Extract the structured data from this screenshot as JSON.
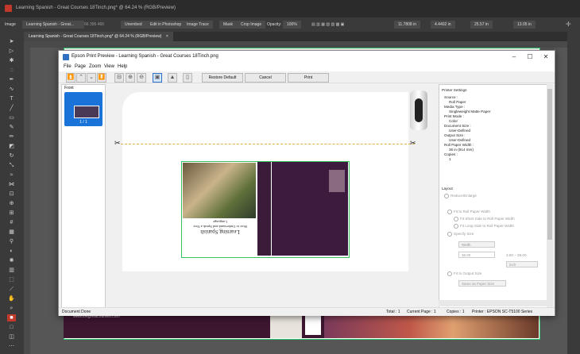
{
  "photoshop": {
    "window_title": "Learning Spanish - Great Courses 18Tinch.png* @ 64.24 % (RGB/Preview)",
    "options_bar": {
      "image_label": "Image",
      "tab_label": "Learning Spanish - Great...",
      "dims": "66  395  466",
      "unembed": "Unembed",
      "edit_in_photoshop": "Edit in Photoshop",
      "image_trace": "Image Trace",
      "mask": "Mask",
      "crop_image": "Crop Image",
      "opacity_label": "Opacity:",
      "opacity_value": "100%",
      "x_value": "11.7808 in",
      "y_value": "4.4402 in",
      "w_value": "25.57 in",
      "h_value": "13.05 in"
    },
    "doc_tab": "Learning Spanish - Great Courses 18Tinch.png* @ 64.24 % (RGB/Preview)",
    "doc_tab_close": "×",
    "artboard_text": [
      "www.thegreatcourses.com"
    ]
  },
  "dialog": {
    "title": "Epson Print Preview - Learning Spanish - Great Courses 18Tinch.png",
    "window_buttons": {
      "minimize": "–",
      "maximize": "☐",
      "close": "✕"
    },
    "menu": [
      "File",
      "Page",
      "Zoom",
      "View",
      "Help"
    ],
    "toolbar": {
      "restore_default": "Restore Default",
      "cancel": "Cancel",
      "print": "Print"
    },
    "thumbnail_panel": {
      "label": "Front",
      "page_caption": "1 / 1"
    },
    "preview": {
      "book_title": "Learning Spanish",
      "book_subtitle": "How to Understand and Speak a New Language"
    },
    "settings": {
      "printer_settings_label": "Printer Settings",
      "source_label": "Source :",
      "source_value": "Roll Paper",
      "media_type_label": "Media Type :",
      "media_type_value": "Singleweight Matte Paper",
      "print_mode_label": "Print Mode :",
      "print_mode_value": "Color",
      "document_size_label": "Document Size :",
      "document_size_value": "User-Defined",
      "output_size_label": "Output Size :",
      "output_size_value": "User-Defined",
      "roll_paper_width_label": "Roll Paper Width :",
      "roll_paper_width_value": "36 in (914 mm)",
      "copies_label": "Copies :",
      "copies_value": "1",
      "layout_label": "Layout",
      "reduce_enlarge": "Reduce/Enlarge",
      "fit_to_roll_paper_width": "Fit to Roll Paper Width",
      "fit_short_side": "Fit Short Side to Roll Paper Width",
      "fit_long_side": "Fit Long Side to Roll Paper Width",
      "specify_size": "Specify Size",
      "width_select": "Width",
      "width_value": "36.00",
      "width_range": "3.50 – 36.00",
      "unit_select": "inch",
      "fit_to_output_size": "Fit to Output Size",
      "same_as_paper_size": "Same as Paper Size"
    },
    "status": {
      "document_state": "Document Done",
      "total": "Total : 1",
      "current_page": "Current Page : 1",
      "copies": "Copies : 1",
      "printer": "Printer : EPSON SC-T5100 Series"
    }
  },
  "colors": {
    "accent_blue": "#1a73d9",
    "page_border": "#38c060",
    "book_purple": "#3d1b3f",
    "cut_line": "#e0b040"
  }
}
